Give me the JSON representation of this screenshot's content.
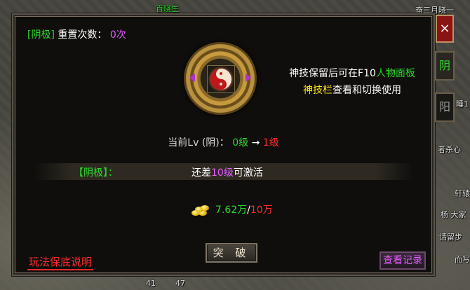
{
  "world": {
    "npc_top_left": "百晓生",
    "npc_top_right": "奋三月晓一",
    "right_labels": [
      "睡1",
      "者杀心",
      "轩辕",
      "杨 大家",
      "请留步",
      "而写"
    ],
    "bottom_numbers": [
      "41",
      "47"
    ]
  },
  "panel": {
    "reset": {
      "tag": "[阴极]",
      "label": "重置次数：",
      "count": "0次"
    },
    "medallion": {
      "icon": "yin-yang-icon"
    },
    "description": {
      "line1_prefix": "神技保留后可在F10",
      "line1_highlight": "人物面板",
      "line2_highlight": "神技栏",
      "line2_suffix": "查看和切换使用"
    },
    "level": {
      "label": "当前Lv (阴)：",
      "current": "0级",
      "arrow": "→",
      "next": "1级"
    },
    "activation": {
      "tag": "【阴极】：",
      "prefix": "还差",
      "value": "10级",
      "suffix": "可激活"
    },
    "cost": {
      "icon": "gold-coins-icon",
      "have": "7.62万",
      "sep": "/",
      "need": "10万"
    },
    "break_button": "突 破",
    "rules_button": "玩法保底说明",
    "records_button": "查看记录"
  },
  "side": {
    "close": "×",
    "tab_yin": "阴",
    "tab_yang": "阳"
  },
  "colors": {
    "green": "#2ad72a",
    "purple": "#e05cff",
    "red": "#ff2a2a",
    "yellow": "#ffe600"
  }
}
